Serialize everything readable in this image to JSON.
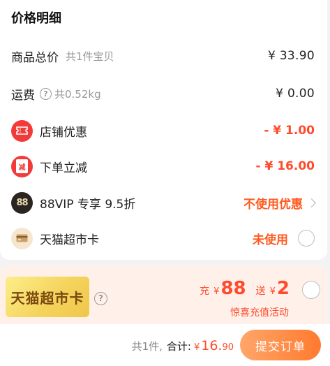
{
  "price_detail": {
    "title": "价格明细",
    "goods": {
      "label": "商品总价",
      "sub": "共1件宝贝",
      "amount": "¥ 33.90"
    },
    "shipping": {
      "label": "运费",
      "weight": "共0.52kg",
      "amount": "¥ 0.00"
    },
    "shop_discount": {
      "label": "店铺优惠",
      "amount": "- ¥ 1.00",
      "icon": "ticket-icon"
    },
    "order_discount": {
      "label": "下单立减",
      "amount": "- ¥ 16.00",
      "icon_glyph": "减"
    },
    "vip": {
      "icon_text": "88",
      "label": "88VIP 专享 9.5折",
      "action": "不使用优惠"
    },
    "tmall_card": {
      "label": "天猫超市卡",
      "status": "未使用",
      "icon": "card-icon"
    }
  },
  "promo": {
    "badge": "天猫超市卡",
    "charge_label": "充",
    "currency": "¥",
    "charge_amount": "88",
    "gift_label": "送",
    "gift_amount": "2",
    "subtitle": "惊喜充值活动"
  },
  "footer": {
    "count": "共1件,",
    "total_label": "合计:",
    "currency": "¥",
    "total_int": "16.",
    "total_dec": "90",
    "submit_label": "提交订单"
  },
  "colors": {
    "accent": "#ff4b2b",
    "submit_gradient_start": "#ffa66a",
    "submit_gradient_end": "#ff7a2e",
    "promo_background": "#fff1ea"
  }
}
